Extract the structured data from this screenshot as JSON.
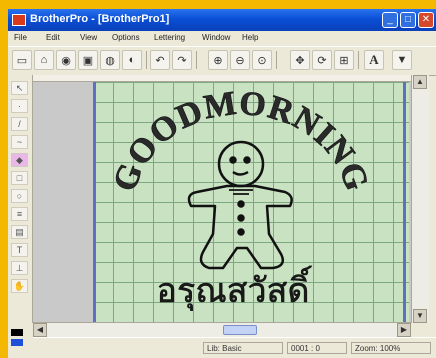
{
  "window": {
    "title": "BrotherPro - [BrotherPro1]"
  },
  "titlebar_buttons": {
    "minimize": "_",
    "maximize": "□",
    "close": "✕"
  },
  "menu": [
    "File",
    "Edit",
    "View",
    "Options",
    "Lettering",
    "Window",
    "Help"
  ],
  "toolbar": {
    "icons": [
      "new-icon",
      "open-icon",
      "zoom-icon",
      "save-icon",
      "print-icon",
      "preview-icon",
      "undo-icon",
      "redo-icon",
      "zoom-in-icon",
      "zoom-out-icon",
      "zoom-fit-icon",
      "move-icon",
      "rotate-icon",
      "grid-icon",
      "text-icon",
      "color-icon"
    ],
    "text_tool_glyph": "A"
  },
  "design": {
    "arc_text": "GOODMORNING",
    "thai_text": "อรุณสวัสดิ์"
  },
  "status": {
    "panel1": "Lib: Basic",
    "panel2": "0001 : 0",
    "panel3": "Zoom: 100%"
  },
  "colors": {
    "thread_black": "#000000",
    "thread_blue": "#1f4fd8",
    "hoop_fill": "#c8e2c2",
    "hoop_border": "#5f6fc4"
  }
}
